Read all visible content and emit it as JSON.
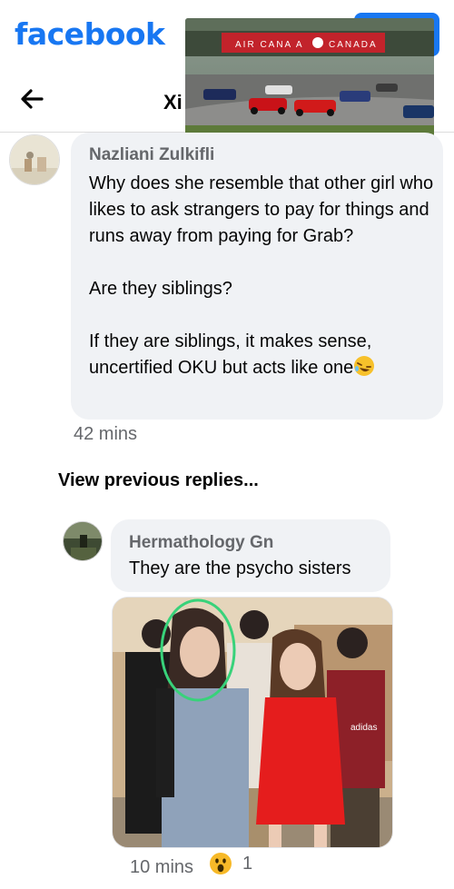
{
  "header": {
    "logo_text": "facebook",
    "brand_color": "#1877f2"
  },
  "subheader": {
    "back_icon": "arrow-left-icon",
    "title": "Xi"
  },
  "video_overlay": {
    "banner_text_left": "AIR CANA A",
    "banner_text_right": "CANADA"
  },
  "comment": {
    "author": "Nazliani Zulkifli",
    "text": "Why does she resemble that other girl who likes to ask strangers to pay for things and runs away from paying for Grab?\n\nAre they siblings?\n\nIf they are siblings, it makes sense, uncertified OKU but acts like one",
    "emoji": "rolling-on-floor-laughing-emoji",
    "time": "42 mins"
  },
  "view_previous": "View previous replies...",
  "reply": {
    "author": "Hermathology Gn",
    "text": "They are the psycho sisters",
    "photo_shirt_text": "adidas",
    "time": "10 mins",
    "reaction_icon": "wow-reaction-icon",
    "reaction_count": "1"
  }
}
